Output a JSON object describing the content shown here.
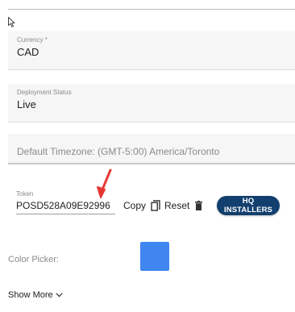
{
  "fields": {
    "currency": {
      "label": "Currency *",
      "value": "CAD"
    },
    "deployment_status": {
      "label": "Deployment Status",
      "value": "Live"
    },
    "timezone": {
      "placeholder": "Default Timezone: (GMT-5:00) America/Toronto"
    }
  },
  "token": {
    "label": "Token",
    "value": "POSD528A09E92996"
  },
  "actions": {
    "copy_label": "Copy",
    "reset_label": "Reset",
    "hq_installers_label": "HQ INSTALLERS"
  },
  "color_picker": {
    "label": "Color Picker:",
    "color": "#3f86f0"
  },
  "show_more": {
    "label": "Show More"
  },
  "icons": {
    "cursor": "mouse-pointer-icon",
    "arrow": "red-arrow-annotation-icon",
    "copy": "copy-icon",
    "reset": "trash-icon",
    "show_more": "chevron-down-icon"
  },
  "colors": {
    "accent_button": "#123f6e",
    "arrow": "#e53935"
  }
}
